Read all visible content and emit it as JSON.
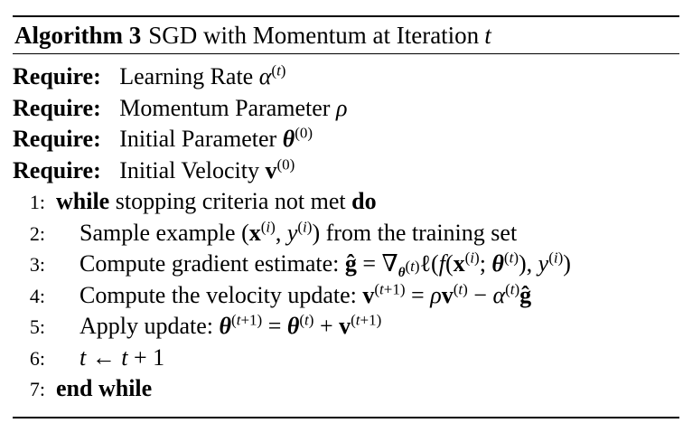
{
  "caption": {
    "label": "Algorithm 3",
    "title": "SGD with Momentum at Iteration",
    "var": "t"
  },
  "requires": [
    {
      "keyword": "Require:",
      "text": "Learning Rate",
      "math": "α",
      "sup": "(t)"
    },
    {
      "keyword": "Require:",
      "text": "Momentum Parameter",
      "math": "ρ",
      "sup": ""
    },
    {
      "keyword": "Require:",
      "text": "Initial Parameter",
      "math": "θ",
      "sup": "(0)"
    },
    {
      "keyword": "Require:",
      "text": "Initial Velocity",
      "math": "v",
      "sup": "(0)"
    }
  ],
  "steps": {
    "s1": {
      "num": "1:",
      "kw_while": "while",
      "text": "stopping criteria not met",
      "kw_do": "do"
    },
    "s2": {
      "num": "2:",
      "text": "Sample example",
      "after": "from the training set"
    },
    "s3": {
      "num": "3:",
      "text": "Compute gradient estimate:"
    },
    "s4": {
      "num": "4:",
      "text": "Compute the velocity update:"
    },
    "s5": {
      "num": "5:",
      "text": "Apply update:"
    },
    "s6": {
      "num": "6:"
    },
    "s7": {
      "num": "7:",
      "kw": "end while"
    }
  }
}
